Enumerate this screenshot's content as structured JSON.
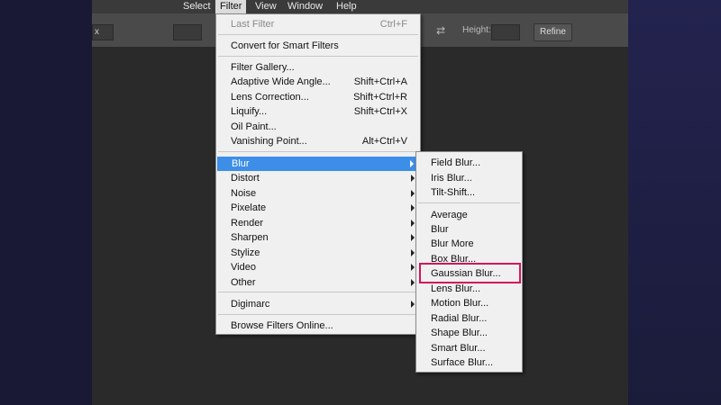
{
  "menubar": {
    "items": [
      {
        "label": "Select"
      },
      {
        "label": "Filter"
      },
      {
        "label": "View"
      },
      {
        "label": "Window"
      },
      {
        "label": "Help"
      }
    ]
  },
  "options_bar": {
    "left_field": "x",
    "height_label": "Height:",
    "refine_button": "Refine"
  },
  "filter_menu": {
    "last_filter": {
      "label": "Last Filter",
      "shortcut": "Ctrl+F"
    },
    "convert": {
      "label": "Convert for Smart Filters"
    },
    "gallery": {
      "label": "Filter Gallery..."
    },
    "adaptive": {
      "label": "Adaptive Wide Angle...",
      "shortcut": "Shift+Ctrl+A"
    },
    "lens": {
      "label": "Lens Correction...",
      "shortcut": "Shift+Ctrl+R"
    },
    "liquify": {
      "label": "Liquify...",
      "shortcut": "Shift+Ctrl+X"
    },
    "oil": {
      "label": "Oil Paint..."
    },
    "vanishing": {
      "label": "Vanishing Point...",
      "shortcut": "Alt+Ctrl+V"
    },
    "blur": {
      "label": "Blur"
    },
    "distort": {
      "label": "Distort"
    },
    "noise": {
      "label": "Noise"
    },
    "pixelate": {
      "label": "Pixelate"
    },
    "render": {
      "label": "Render"
    },
    "sharpen": {
      "label": "Sharpen"
    },
    "stylize": {
      "label": "Stylize"
    },
    "video": {
      "label": "Video"
    },
    "other": {
      "label": "Other"
    },
    "digimarc": {
      "label": "Digimarc"
    },
    "browse": {
      "label": "Browse Filters Online..."
    }
  },
  "blur_submenu": {
    "field_blur": "Field Blur...",
    "iris_blur": "Iris Blur...",
    "tilt_shift": "Tilt-Shift...",
    "average": "Average",
    "blur": "Blur",
    "blur_more": "Blur More",
    "box_blur": "Box Blur...",
    "gaussian_blur": "Gaussian Blur...",
    "lens_blur": "Lens Blur...",
    "motion_blur": "Motion Blur...",
    "radial_blur": "Radial Blur...",
    "shape_blur": "Shape Blur...",
    "smart_blur": "Smart Blur...",
    "surface_blur": "Surface Blur..."
  },
  "colors": {
    "highlight": "#3d8ee6",
    "annotation_box": "#d2155b"
  }
}
